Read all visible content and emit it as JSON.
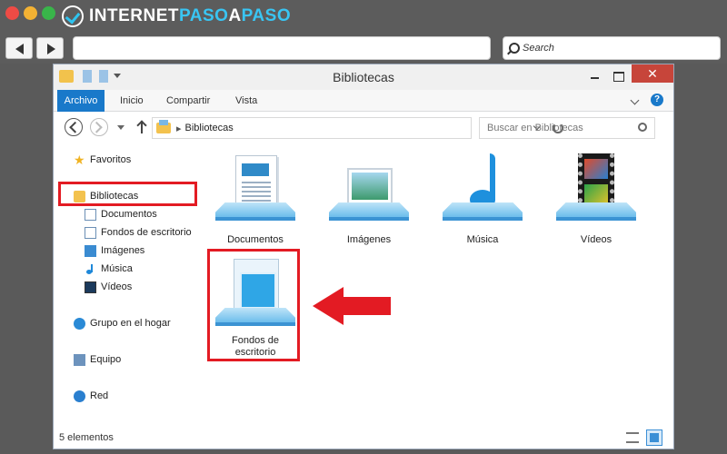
{
  "brand": {
    "name_part1": "INTERNET",
    "name_part2": "PASO",
    "name_part3": "A",
    "name_part4": "PASO"
  },
  "browser": {
    "search_placeholder": "Search"
  },
  "window": {
    "title": "Bibliotecas",
    "close_symbol": "✕",
    "help_symbol": "?"
  },
  "ribbon": {
    "tabs": [
      "Archivo",
      "Inicio",
      "Compartir",
      "Vista"
    ]
  },
  "address": {
    "separator": "▸",
    "path": "Bibliotecas",
    "search_placeholder": "Buscar en Bibliotecas"
  },
  "nav": {
    "favorites": "Favoritos",
    "libraries": "Bibliotecas",
    "library_items": [
      "Documentos",
      "Fondos de escritorio",
      "Imágenes",
      "Música",
      "Vídeos"
    ],
    "homegroup": "Grupo en el hogar",
    "computer": "Equipo",
    "network": "Red"
  },
  "content": {
    "tiles": [
      "Documentos",
      "Imágenes",
      "Música",
      "Vídeos"
    ],
    "selected_tile_line1": "Fondos de",
    "selected_tile_line2": "escritorio"
  },
  "status": {
    "count": "5 elementos"
  },
  "colors": {
    "accent": "#1979ca",
    "highlight": "#e31b23"
  }
}
